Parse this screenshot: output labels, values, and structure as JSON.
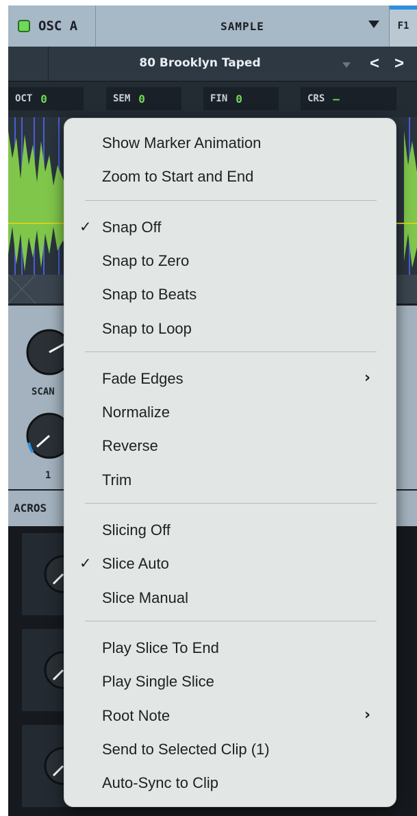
{
  "osc": {
    "title": "OSC A",
    "led_color": "#6ed957"
  },
  "mode": {
    "value": "SAMPLE"
  },
  "filter": {
    "label": "F1"
  },
  "sample": {
    "name": "80 Brooklyn Taped",
    "prev": "<",
    "next": ">"
  },
  "params": [
    {
      "label": "OCT",
      "value": "0"
    },
    {
      "label": "SEM",
      "value": "0"
    },
    {
      "label": "FIN",
      "value": "0"
    },
    {
      "label": "CRS",
      "value": "–"
    }
  ],
  "knobs": {
    "scan_label": "SCAN",
    "one_label": "1"
  },
  "macros": {
    "title": "ACROS"
  },
  "colors": {
    "accent_green": "#6ed957",
    "accent_blue": "#2f8fe0",
    "waveform": "#7fc64a",
    "marker": "#d7d21c"
  },
  "menu": {
    "groups": [
      [
        {
          "label": "Show Marker Animation",
          "checked": false,
          "submenu": false
        },
        {
          "label": "Zoom to Start and End",
          "checked": false,
          "submenu": false
        }
      ],
      [
        {
          "label": "Snap Off",
          "checked": true,
          "submenu": false
        },
        {
          "label": "Snap to Zero",
          "checked": false,
          "submenu": false
        },
        {
          "label": "Snap to Beats",
          "checked": false,
          "submenu": false
        },
        {
          "label": "Snap to Loop",
          "checked": false,
          "submenu": false
        }
      ],
      [
        {
          "label": "Fade Edges",
          "checked": false,
          "submenu": true
        },
        {
          "label": "Normalize",
          "checked": false,
          "submenu": false
        },
        {
          "label": "Reverse",
          "checked": false,
          "submenu": false
        },
        {
          "label": "Trim",
          "checked": false,
          "submenu": false
        }
      ],
      [
        {
          "label": "Slicing Off",
          "checked": false,
          "submenu": false
        },
        {
          "label": "Slice Auto",
          "checked": true,
          "submenu": false
        },
        {
          "label": "Slice Manual",
          "checked": false,
          "submenu": false
        }
      ],
      [
        {
          "label": "Play Slice To End",
          "checked": false,
          "submenu": false
        },
        {
          "label": "Play Single Slice",
          "checked": false,
          "submenu": false
        },
        {
          "label": "Root Note",
          "checked": false,
          "submenu": true
        },
        {
          "label": "Send to Selected Clip (1)",
          "checked": false,
          "submenu": false
        },
        {
          "label": "Auto-Sync to Clip",
          "checked": false,
          "submenu": false
        }
      ]
    ],
    "check_glyph": "✓",
    "submenu_glyph": "›"
  }
}
